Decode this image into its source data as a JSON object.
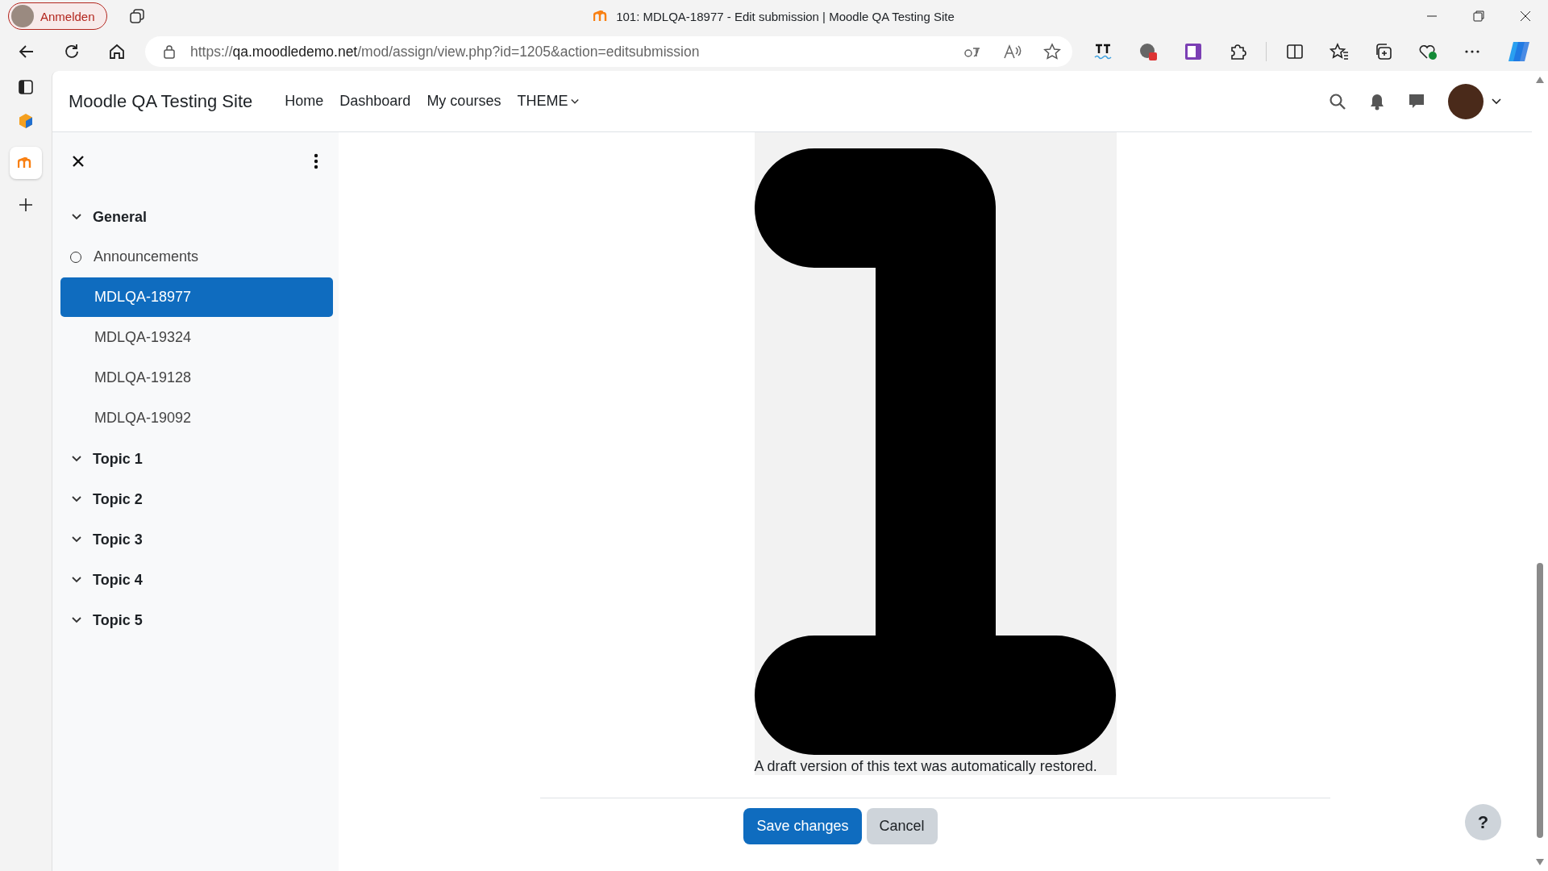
{
  "browser": {
    "profile_label": "Anmelden",
    "tab_title": "101: MDLQA-18977 - Edit submission | Moodle QA Testing Site",
    "url_host": "qa.moodledemo.net",
    "url_prefix": "https://",
    "url_path": "/mod/assign/view.php?id=1205&action=editsubmission"
  },
  "navbar": {
    "site_name": "Moodle QA Testing Site",
    "links": [
      {
        "label": "Home",
        "dropdown": false
      },
      {
        "label": "Dashboard",
        "dropdown": false
      },
      {
        "label": "My courses",
        "dropdown": false
      },
      {
        "label": "THEME",
        "dropdown": true
      }
    ]
  },
  "course_index": {
    "items": [
      {
        "kind": "section",
        "label": "General",
        "children": [
          {
            "kind": "activity",
            "label": "Announcements",
            "selected": false,
            "bullet": true
          },
          {
            "kind": "activity",
            "label": "MDLQA-18977",
            "selected": true,
            "bullet": false
          },
          {
            "kind": "activity",
            "label": "MDLQA-19324",
            "selected": false,
            "bullet": false
          },
          {
            "kind": "activity",
            "label": "MDLQA-19128",
            "selected": false,
            "bullet": false
          },
          {
            "kind": "activity",
            "label": "MDLQA-19092",
            "selected": false,
            "bullet": false
          }
        ]
      },
      {
        "kind": "section",
        "label": "Topic 1"
      },
      {
        "kind": "section",
        "label": "Topic 2"
      },
      {
        "kind": "section",
        "label": "Topic 3"
      },
      {
        "kind": "section",
        "label": "Topic 4"
      },
      {
        "kind": "section",
        "label": "Topic 5"
      }
    ]
  },
  "editor": {
    "caption": "A draft version of this text was automatically restored."
  },
  "buttons": [
    {
      "kind": "primary",
      "label": "Save changes"
    },
    {
      "kind": "secondary",
      "label": "Cancel"
    }
  ],
  "help": {
    "label": "?"
  }
}
